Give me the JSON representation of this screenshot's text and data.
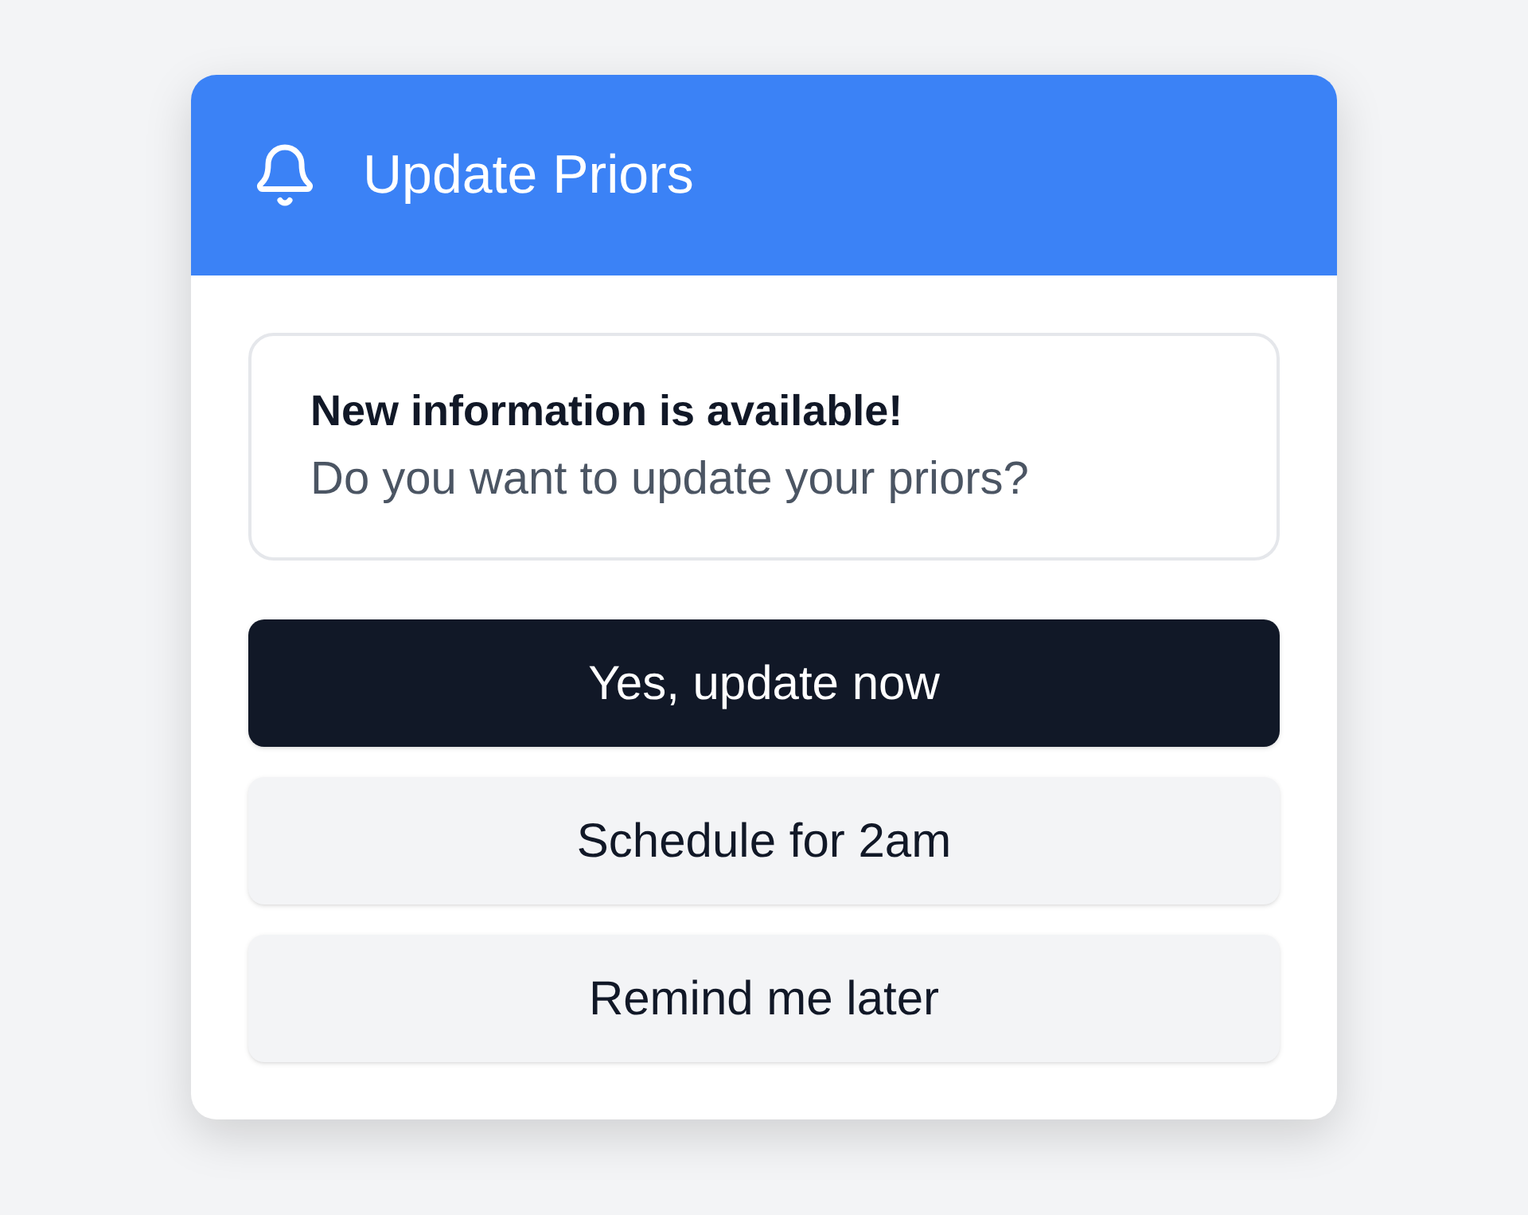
{
  "dialog": {
    "title": "Update Priors"
  },
  "message": {
    "heading": "New information is available!",
    "body": "Do you want to update your priors?"
  },
  "buttons": [
    {
      "label": "Yes, update now",
      "kind": "primary"
    },
    {
      "label": "Schedule for 2am",
      "kind": "secondary"
    },
    {
      "label": "Remind me later",
      "kind": "secondary"
    }
  ]
}
